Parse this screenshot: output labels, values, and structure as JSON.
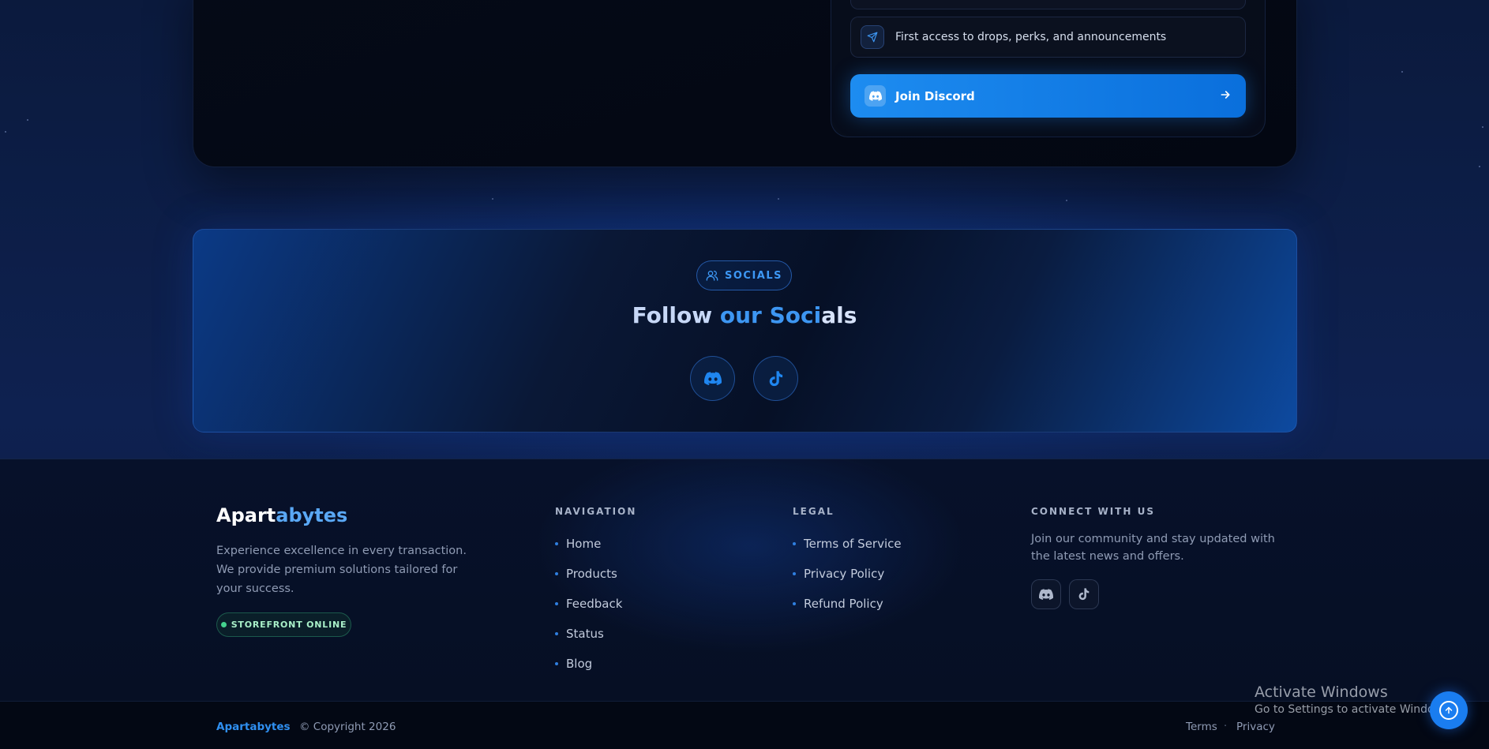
{
  "discord_card": {
    "perk_text": "First access to drops, perks, and announcements",
    "join_label": "Join Discord",
    "perk_icon": "send-icon",
    "join_icon": "discord-icon",
    "arrow_icon": "arrow-right-icon"
  },
  "socials": {
    "pill_label": "SOCIALS",
    "title_part1": "Follow",
    "title_part2": "our Soci",
    "title_part3": "als",
    "links": [
      {
        "icon": "discord-icon"
      },
      {
        "icon": "tiktok-icon"
      }
    ]
  },
  "footer": {
    "brand_part1": "Apart",
    "brand_part2": "abytes",
    "description": "Experience excellence in every transaction. We provide premium solutions tailored for your success.",
    "status": "STOREFRONT ONLINE",
    "navigation": {
      "title": "NAVIGATION",
      "links": [
        "Home",
        "Products",
        "Feedback",
        "Status",
        "Blog"
      ]
    },
    "legal": {
      "title": "LEGAL",
      "links": [
        "Terms of Service",
        "Privacy Policy",
        "Refund Policy"
      ]
    },
    "connect": {
      "title": "CONNECT WITH US",
      "description": "Join our community and stay updated with the latest news and offers.",
      "icons": [
        "discord-icon",
        "tiktok-icon"
      ]
    }
  },
  "bottom_bar": {
    "brand": "Apartabytes",
    "separator": "·",
    "copyright": "© Copyright 2026",
    "terms": "Terms",
    "privacy": "Privacy"
  },
  "watermark": {
    "line1": "Activate Windows",
    "line2": "Go to Settings to activate Windows."
  },
  "colors": {
    "accent": "#1d8cf0",
    "status_green": "#44d28e",
    "background": "#0c1a3a"
  }
}
